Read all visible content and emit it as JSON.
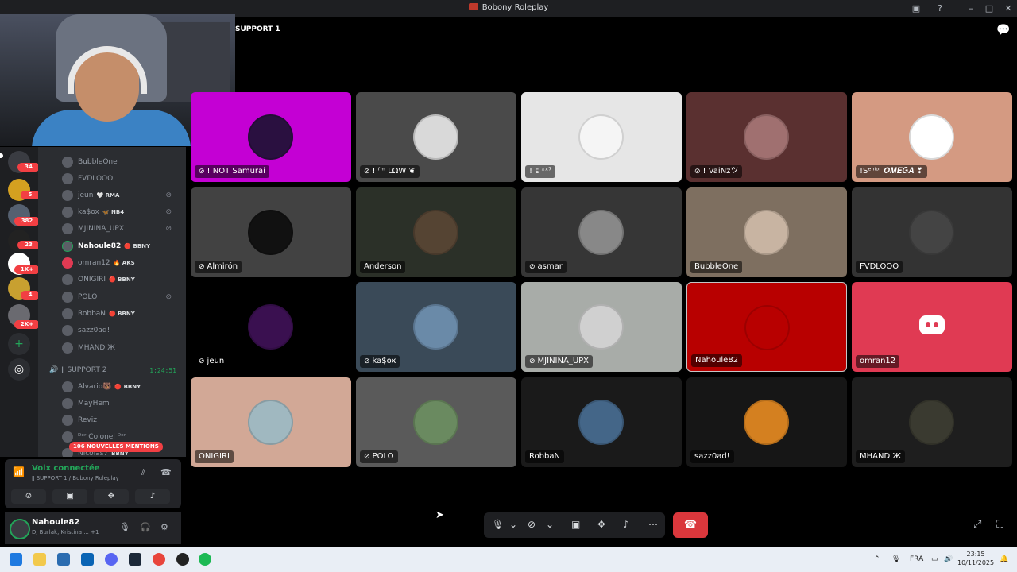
{
  "window": {
    "title": "Bobony Roleplay"
  },
  "header": {
    "channel": "SUPPORT 1"
  },
  "servers": [
    {
      "badge": "34"
    },
    {
      "badge": "5"
    },
    {
      "badge": "382"
    },
    {
      "badge": "23"
    },
    {
      "badge": "1K+"
    },
    {
      "badge": "4"
    },
    {
      "badge": "2K+"
    }
  ],
  "sidebar_users": [
    {
      "name": "BubbleOne",
      "tag": "",
      "muted": false
    },
    {
      "name": "FVDLOOO",
      "tag": "",
      "muted": false
    },
    {
      "name": "jeun",
      "tag": "🤍 RMA",
      "muted": true
    },
    {
      "name": "ka$ox",
      "tag": "🦋 NB4",
      "muted": true
    },
    {
      "name": "MJININA_UPX",
      "tag": "",
      "muted": true
    },
    {
      "name": "Nahoule82",
      "tag": "🔴 BBNY",
      "muted": false
    },
    {
      "name": "omran12",
      "tag": "🔥 AKS",
      "muted": false
    },
    {
      "name": "ONIGIRI",
      "tag": "🔴 BBNY",
      "muted": false
    },
    {
      "name": "POLO",
      "tag": "",
      "muted": true
    },
    {
      "name": "RobbaN",
      "tag": "🔴 BBNY",
      "muted": false
    },
    {
      "name": "sazz0ad!",
      "tag": "",
      "muted": false
    },
    {
      "name": "MHAND Ж",
      "tag": "",
      "muted": false
    }
  ],
  "support2": {
    "name": "ǁ SUPPORT 2",
    "timer": "1:24:51"
  },
  "support2_users": [
    {
      "name": "Alvario🐻",
      "tag": "🔴 BBNY"
    },
    {
      "name": "MayHem",
      "tag": ""
    },
    {
      "name": "Reviz",
      "tag": ""
    },
    {
      "name": "ᴰᵉʳ Colonel ᴰᵉʳ",
      "tag": ""
    },
    {
      "name": "Nicolas7",
      "tag": "BBNY"
    }
  ],
  "mentions": "106 NOUVELLES MENTIONS",
  "voice": {
    "status": "Voix connectée",
    "channel": "ǁ SUPPORT 1 / Bobony Roleplay"
  },
  "user": {
    "name": "Nahoule82",
    "status": "DJ Burlak, Kristina ...",
    "extra": "+1"
  },
  "tiles": [
    {
      "name": "! NOT Samurai",
      "muted": true,
      "bg": "#c400d4",
      "av": "#2a1040"
    },
    {
      "name": "! ᶠᵐ LΩW ❦",
      "muted": true,
      "bg": "#4a4a4a",
      "av": "#d9d9d9"
    },
    {
      "name": "! ᴇ ˣˣ⁷",
      "muted": false,
      "bg": "#e6e6e6",
      "av": "#f5f5f5"
    },
    {
      "name": "! VaiNzツ",
      "muted": true,
      "bg": "#5a3030",
      "av": "#a07070"
    },
    {
      "name": "!Sᵉⁿⁱᵒʳ 𝑶𝑴𝑬𝑮𝑨 ❣",
      "muted": false,
      "bg": "#d49a82",
      "av": "#ffffff"
    },
    {
      "name": "Almirón",
      "muted": true,
      "bg": "#424242",
      "av": "#111111"
    },
    {
      "name": "Anderson",
      "muted": false,
      "bg": "#2b3028",
      "av": "#554433"
    },
    {
      "name": "asmar",
      "muted": true,
      "bg": "#363636",
      "av": "#888888"
    },
    {
      "name": "BubbleOne",
      "muted": false,
      "bg": "#7e6f60",
      "av": "#c8b4a2"
    },
    {
      "name": "FVDLOOO",
      "muted": false,
      "bg": "#333333",
      "av": "#444444"
    },
    {
      "name": "jeun",
      "muted": true,
      "bg": "#000000",
      "av": "#3a1050"
    },
    {
      "name": "ka$ox",
      "muted": true,
      "bg": "#3a4a58",
      "av": "#6a8aa8"
    },
    {
      "name": "MJININA_UPX",
      "muted": true,
      "bg": "#a8aca8",
      "av": "#d0d0d0"
    },
    {
      "name": "Nahoule82",
      "muted": false,
      "bg": "#b80000",
      "av": "#b80000",
      "speaking": true
    },
    {
      "name": "omran12",
      "muted": false,
      "bg": "#e03a53",
      "av": "",
      "discord": true
    },
    {
      "name": "ONIGIRI",
      "muted": false,
      "bg": "#d2a896",
      "av": "#a0b8c0"
    },
    {
      "name": "POLO",
      "muted": true,
      "bg": "#5a5a5a",
      "av": "#6a8a60"
    },
    {
      "name": "RobbaN",
      "muted": false,
      "bg": "#1a1a1a",
      "av": "#446688"
    },
    {
      "name": "sazz0ad!",
      "muted": false,
      "bg": "#161616",
      "av": "#d48020"
    },
    {
      "name": "MHAND Ж",
      "muted": false,
      "bg": "#1e1e1e",
      "av": "#3a3a30"
    }
  ],
  "taskbar": {
    "lang": "FRA",
    "time": "23:15",
    "date": "10/11/2025"
  }
}
